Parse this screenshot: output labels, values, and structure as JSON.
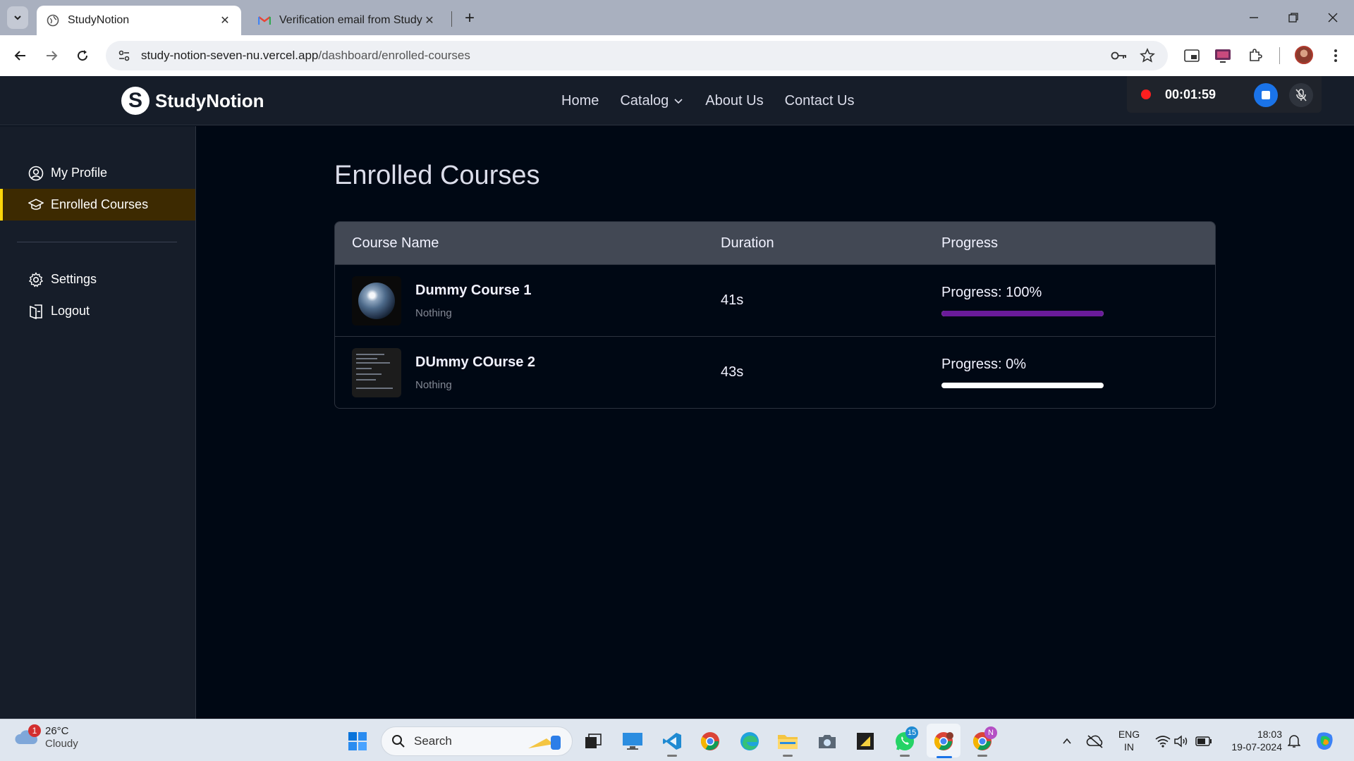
{
  "browser": {
    "tabs": [
      {
        "title": "StudyNotion",
        "active": true
      },
      {
        "title": "Verification email from StudyNotion",
        "active": false
      }
    ],
    "url_host": "study-notion-seven-nu.vercel.app",
    "url_path": "/dashboard/enrolled-courses"
  },
  "site": {
    "logo_text": "StudyNotion",
    "logo_letter": "S",
    "nav": [
      {
        "label": "Home"
      },
      {
        "label": "Catalog"
      },
      {
        "label": "About Us"
      },
      {
        "label": "Contact Us"
      }
    ]
  },
  "recorder": {
    "time": "00:01:59"
  },
  "sidebar": {
    "items": [
      {
        "label": "My Profile",
        "icon": "user-circle-icon",
        "active": false
      },
      {
        "label": "Enrolled Courses",
        "icon": "graduation-cap-icon",
        "active": true
      }
    ],
    "bottom_items": [
      {
        "label": "Settings",
        "icon": "gear-icon"
      },
      {
        "label": "Logout",
        "icon": "logout-icon"
      }
    ]
  },
  "main": {
    "title": "Enrolled Courses",
    "columns": {
      "name": "Course Name",
      "duration": "Duration",
      "progress": "Progress"
    },
    "courses": [
      {
        "name": "Dummy Course 1",
        "description": "Nothing",
        "duration": "41s",
        "progress_label": "Progress: 100%",
        "progress_percent": 100
      },
      {
        "name": "DUmmy COurse 2",
        "description": "Nothing",
        "duration": "43s",
        "progress_label": "Progress: 0%",
        "progress_percent": 0
      }
    ]
  },
  "taskbar": {
    "weather_temp": "26°C",
    "weather_cond": "Cloudy",
    "weather_badge": "1",
    "search_placeholder": "Search",
    "whatsapp_badge": "15",
    "chrome_profile_badge": "N",
    "lang_top": "ENG",
    "lang_bottom": "IN",
    "time": "18:03",
    "date": "19-07-2024"
  },
  "colors": {
    "accent_yellow": "#ffd60a",
    "progress_fill": "#6a1b9a",
    "nav_bg": "#161d29",
    "page_bg": "#000814"
  }
}
